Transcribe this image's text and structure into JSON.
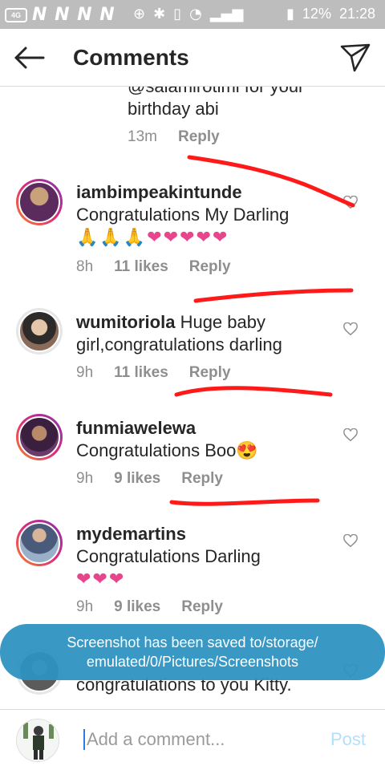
{
  "status_bar": {
    "left_badge": "4G",
    "carrier_marks": "N N N N",
    "battery": "12%",
    "time": "21:28"
  },
  "header": {
    "title": "Comments"
  },
  "comments": [
    {
      "text_fragment": "@salamirotimi for your birthday abi",
      "time": "13m",
      "likes": "",
      "reply": "Reply"
    },
    {
      "username": "iambimpeakintunde",
      "text": "Congratulations My Darling",
      "emoji_line": "🙏🙏🙏❤❤❤❤❤",
      "time": "8h",
      "likes": "11 likes",
      "reply": "Reply"
    },
    {
      "username": "wumitoriola",
      "text": "Huge baby girl,congratulations darling",
      "time": "9h",
      "likes": "11 likes",
      "reply": "Reply"
    },
    {
      "username": "funmiawelewa",
      "text": "Congratulations Boo😍",
      "time": "9h",
      "likes": "9 likes",
      "reply": "Reply"
    },
    {
      "username": "mydemartins",
      "text": "Congratulations Darling",
      "emoji_line": "❤❤❤",
      "time": "9h",
      "likes": "9 likes",
      "reply": "Reply"
    },
    {
      "text_fragment": "congratulations to you Kitty."
    }
  ],
  "toast": {
    "line1": "Screenshot has been saved to/storage/",
    "line2": "emulated/0/Pictures/Screenshots"
  },
  "composer": {
    "placeholder": "Add a comment...",
    "post_label": "Post"
  },
  "colors": {
    "accent_blue": "#2E93C1",
    "post_disabled": "#B2DFFC",
    "meta_gray": "#8E8E8E",
    "scribble_red": "#FF1A1A"
  }
}
